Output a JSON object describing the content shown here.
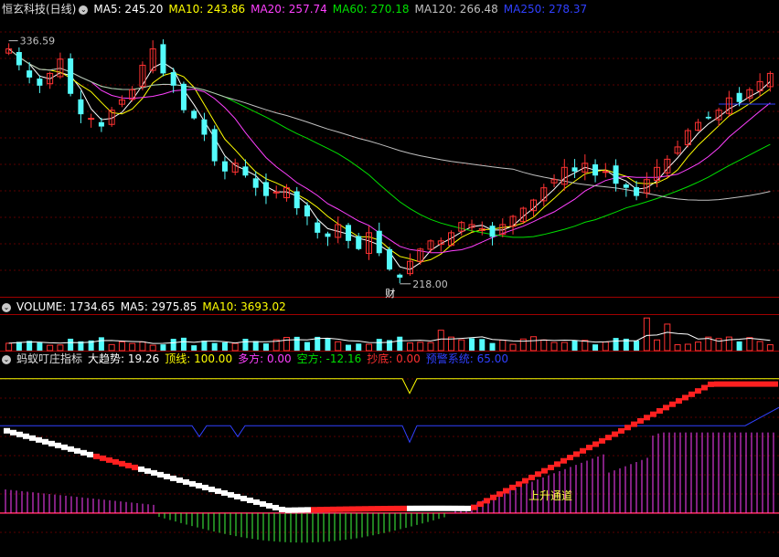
{
  "chart_data": [
    {
      "type": "candlestick",
      "title": "恒玄科技(日线)",
      "indicators": [
        {
          "name": "MA5",
          "value": "245.20",
          "color": "#ffffff"
        },
        {
          "name": "MA10",
          "value": "243.86",
          "color": "#ffff00"
        },
        {
          "name": "MA20",
          "value": "257.74",
          "color": "#ff40ff"
        },
        {
          "name": "MA60",
          "value": "270.18",
          "color": "#00e000"
        },
        {
          "name": "MA120",
          "value": "266.48",
          "color": "#c0c0c0"
        },
        {
          "name": "MA250",
          "value": "278.37",
          "color": "#3040ff"
        }
      ],
      "high_label": "336.59",
      "low_label": "218.00",
      "event_marker": "财",
      "y_range": [
        210,
        345
      ],
      "close_path": [
        330,
        322,
        316,
        312,
        318,
        325,
        308,
        298,
        296,
        292,
        300,
        305,
        310,
        322,
        330,
        318,
        312,
        300,
        296,
        288,
        275,
        270,
        274,
        268,
        262,
        258,
        260,
        262,
        252,
        248,
        240,
        238,
        244,
        236,
        232,
        240,
        230,
        222,
        218,
        226,
        232,
        236,
        236,
        240,
        245,
        244,
        242,
        238,
        244,
        248,
        252,
        256,
        262,
        266,
        272,
        270,
        274,
        268,
        270,
        264,
        262,
        258,
        266,
        272,
        276,
        282,
        290,
        294,
        296,
        300,
        306,
        304,
        310,
        314,
        318
      ]
    },
    {
      "type": "bar",
      "title": "VOLUME",
      "indicators": [
        {
          "name": "VOLUME",
          "value": "1734.65",
          "color": "#ffffff"
        },
        {
          "name": "MA5",
          "value": "2975.85",
          "color": "#ffffff"
        },
        {
          "name": "MA10",
          "value": "3693.02",
          "color": "#ffff00"
        }
      ]
    },
    {
      "type": "line",
      "title": "蚂蚁叮庄指标",
      "indicators": [
        {
          "name": "大趋势",
          "value": "19.26",
          "color": "#ffffff"
        },
        {
          "name": "顶线",
          "value": "100.00",
          "color": "#ffff00"
        },
        {
          "name": "多方",
          "value": "0.00",
          "color": "#ff40ff"
        },
        {
          "name": "空方",
          "value": "-12.16",
          "color": "#00e000"
        },
        {
          "name": "抄底",
          "value": "0.00",
          "color": "#ff3030"
        },
        {
          "name": "预警系统",
          "value": "65.00",
          "color": "#3040ff"
        }
      ],
      "annotation": "上升通道",
      "levels": {
        "top": 100,
        "warning": 65,
        "zero": 0
      },
      "y_range": [
        -30,
        110
      ]
    }
  ]
}
